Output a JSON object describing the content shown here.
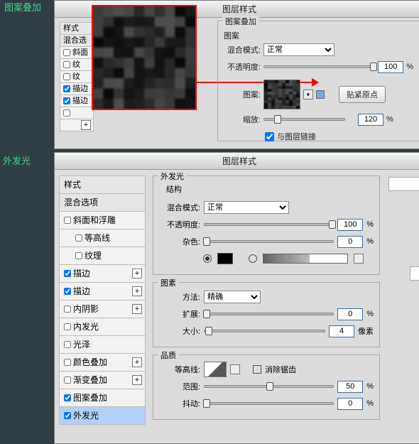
{
  "tags": {
    "pattern_overlay": "图案叠加",
    "outer_glow": "外发光"
  },
  "top": {
    "dialog_title": "图层样式",
    "styles_header": "样式",
    "blend_options": "混合选",
    "items": [
      "斜面",
      "纹",
      "纹",
      "描边",
      "描边"
    ],
    "section": "图案叠加",
    "pattern_sub": "图案",
    "blend_mode_label": "混合模式:",
    "blend_mode_value": "正常",
    "opacity_label": "不透明度:",
    "opacity_value": "100",
    "pattern_label": "图案:",
    "snap_button": "贴紧原点",
    "scale_label": "缩放:",
    "scale_value": "120",
    "link_label": "与图层链接",
    "percent": "%"
  },
  "bottom": {
    "dialog_title": "图层样式",
    "styles_header": "样式",
    "blend_options": "混合选项",
    "list": [
      {
        "label": "斜面和浮雕",
        "checked": false,
        "indent": false,
        "plus": false
      },
      {
        "label": "等高线",
        "checked": false,
        "indent": true,
        "plus": false
      },
      {
        "label": "纹理",
        "checked": false,
        "indent": true,
        "plus": false
      },
      {
        "label": "描边",
        "checked": true,
        "indent": false,
        "plus": true
      },
      {
        "label": "描边",
        "checked": true,
        "indent": false,
        "plus": true
      },
      {
        "label": "内阴影",
        "checked": false,
        "indent": false,
        "plus": true
      },
      {
        "label": "内发光",
        "checked": false,
        "indent": false,
        "plus": false
      },
      {
        "label": "光泽",
        "checked": false,
        "indent": false,
        "plus": false
      },
      {
        "label": "颜色叠加",
        "checked": false,
        "indent": false,
        "plus": true
      },
      {
        "label": "渐变叠加",
        "checked": false,
        "indent": false,
        "plus": true
      },
      {
        "label": "图案叠加",
        "checked": true,
        "indent": false,
        "plus": false
      },
      {
        "label": "外发光",
        "checked": true,
        "indent": false,
        "plus": false,
        "selected": true
      }
    ],
    "glow": {
      "title": "外发光",
      "structure": "结构",
      "blend_mode_label": "混合模式:",
      "blend_mode_value": "正常",
      "opacity_label": "不透明度:",
      "opacity_value": "100",
      "noise_label": "杂色:",
      "noise_value": "0",
      "elements_title": "图素",
      "method_label": "方法:",
      "method_value": "精确",
      "spread_label": "扩展:",
      "spread_value": "0",
      "size_label": "大小:",
      "size_value": "4",
      "size_unit": "像素",
      "quality_title": "品质",
      "contour_label": "等高线:",
      "antialias_label": "消除锯齿",
      "range_label": "范围:",
      "range_value": "50",
      "jitter_label": "抖动:",
      "jitter_value": "0",
      "percent": "%"
    }
  }
}
